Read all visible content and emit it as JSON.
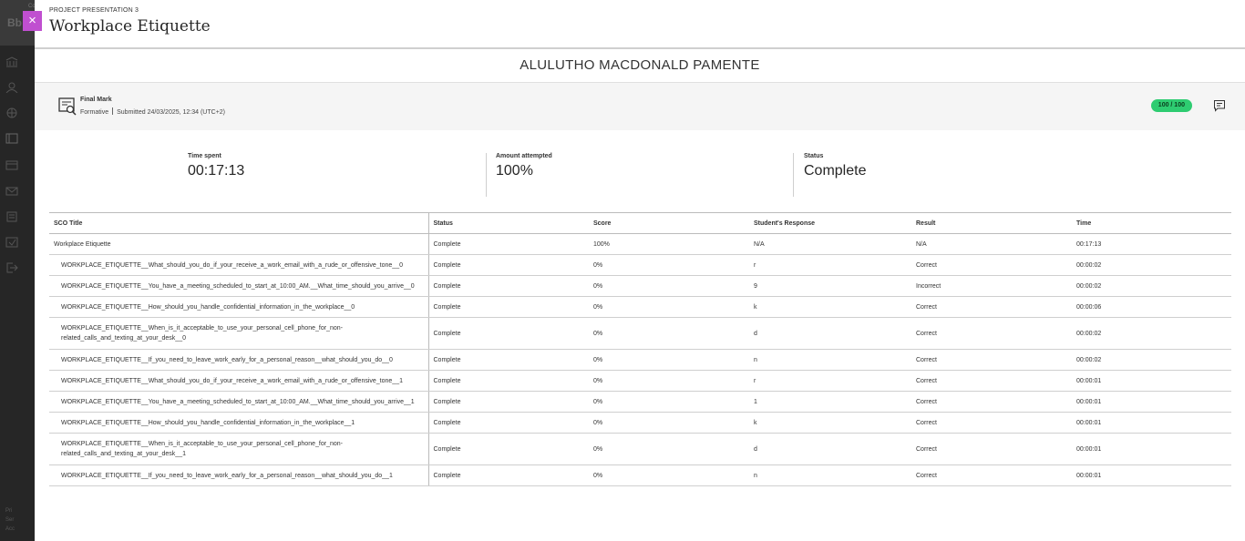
{
  "background": {
    "logo": "Bb",
    "corner": "Cc",
    "footer_lines": [
      "Pri",
      "Ser",
      "Acc"
    ]
  },
  "close_label": "×",
  "header": {
    "eyebrow": "PROJECT PRESENTATION 3",
    "title": "Workplace Etiquette"
  },
  "student_name": "ALULUTHO MACDONALD PAMENTE",
  "grade": {
    "name": "Final Mark",
    "type": "Formative",
    "submitted": "Submitted 24/03/2025, 12:34 (UTC+2)",
    "score": "100 / 100",
    "score_color": "#2ecc71"
  },
  "stats": {
    "time_spent_label": "Time spent",
    "time_spent_value": "00:17:13",
    "attempted_label": "Amount attempted",
    "attempted_value": "100%",
    "status_label": "Status",
    "status_value": "Complete"
  },
  "table": {
    "columns": [
      "SCO Title",
      "Status",
      "Score",
      "Student's Response",
      "Result",
      "Time"
    ],
    "rows": [
      {
        "title": "Workplace Etiquette",
        "status": "Complete",
        "score": "100%",
        "response": "N/A",
        "result": "N/A",
        "time": "00:17:13"
      },
      {
        "title": "WORKPLACE_ETIQUETTE__What_should_you_do_if_your_receive_a_work_email_with_a_rude_or_offensive_tone__0",
        "status": "Complete",
        "score": "0%",
        "response": "r",
        "result": "Correct",
        "time": "00:00:02"
      },
      {
        "title": "WORKPLACE_ETIQUETTE__You_have_a_meeting_scheduled_to_start_at_10:00_AM.__What_time_should_you_arrive__0",
        "status": "Complete",
        "score": "0%",
        "response": "9",
        "result": "Incorrect",
        "time": "00:00:02"
      },
      {
        "title": "WORKPLACE_ETIQUETTE__How_should_you_handle_confidential_information_in_the_workplace__0",
        "status": "Complete",
        "score": "0%",
        "response": "k",
        "result": "Correct",
        "time": "00:00:06"
      },
      {
        "title": "WORKPLACE_ETIQUETTE__When_is_it_acceptable_to_use_your_personal_cell_phone_for_non-related_calls_and_texting_at_your_desk__0",
        "status": "Complete",
        "score": "0%",
        "response": "d",
        "result": "Correct",
        "time": "00:00:02"
      },
      {
        "title": "WORKPLACE_ETIQUETTE__If_you_need_to_leave_work_early_for_a_personal_reason__what_should_you_do__0",
        "status": "Complete",
        "score": "0%",
        "response": "n",
        "result": "Correct",
        "time": "00:00:02"
      },
      {
        "title": "WORKPLACE_ETIQUETTE__What_should_you_do_if_your_receive_a_work_email_with_a_rude_or_offensive_tone__1",
        "status": "Complete",
        "score": "0%",
        "response": "r",
        "result": "Correct",
        "time": "00:00:01"
      },
      {
        "title": "WORKPLACE_ETIQUETTE__You_have_a_meeting_scheduled_to_start_at_10:00_AM.__What_time_should_you_arrive__1",
        "status": "Complete",
        "score": "0%",
        "response": "1",
        "result": "Correct",
        "time": "00:00:01"
      },
      {
        "title": "WORKPLACE_ETIQUETTE__How_should_you_handle_confidential_information_in_the_workplace__1",
        "status": "Complete",
        "score": "0%",
        "response": "k",
        "result": "Correct",
        "time": "00:00:01"
      },
      {
        "title": "WORKPLACE_ETIQUETTE__When_is_it_acceptable_to_use_your_personal_cell_phone_for_non-related_calls_and_texting_at_your_desk__1",
        "status": "Complete",
        "score": "0%",
        "response": "d",
        "result": "Correct",
        "time": "00:00:01"
      },
      {
        "title": "WORKPLACE_ETIQUETTE__If_you_need_to_leave_work_early_for_a_personal_reason__what_should_you_do__1",
        "status": "Complete",
        "score": "0%",
        "response": "n",
        "result": "Correct",
        "time": "00:00:01"
      }
    ]
  }
}
